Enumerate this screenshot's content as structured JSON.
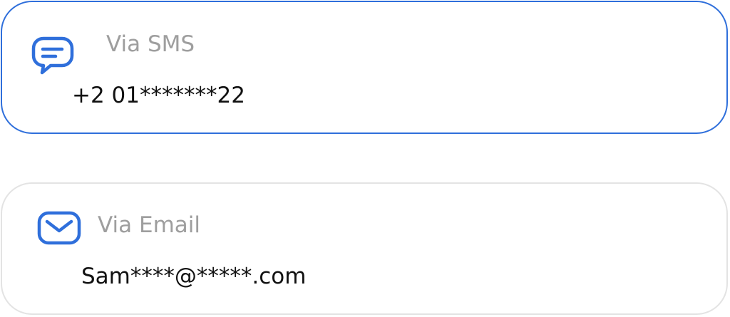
{
  "accent_color": "#2f6fdb",
  "options": {
    "sms": {
      "label": "Via SMS",
      "value": "+2 01*******22",
      "icon": "chat-bubble-icon",
      "selected": true
    },
    "email": {
      "label": "Via Email",
      "value": "Sam****@*****.com",
      "icon": "envelope-icon",
      "selected": false
    }
  }
}
